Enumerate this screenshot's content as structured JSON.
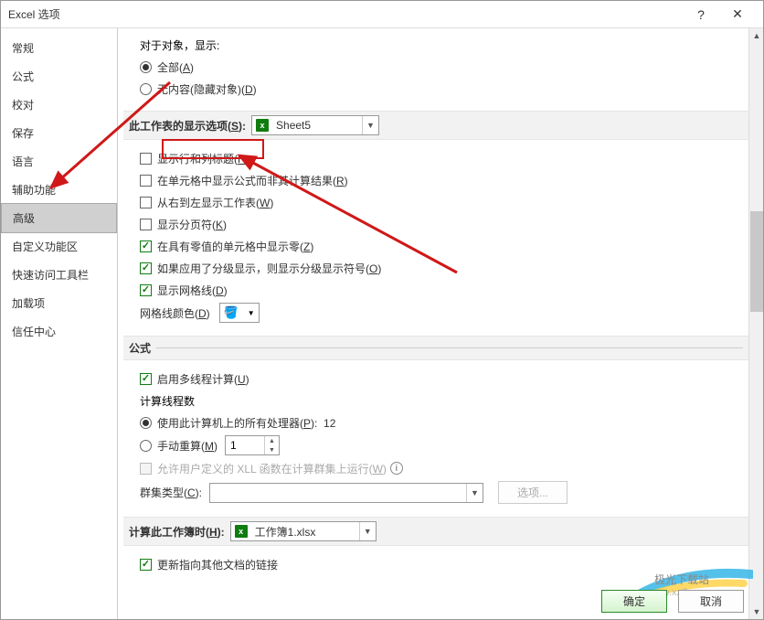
{
  "titlebar": {
    "title": "Excel 选项",
    "help": "?",
    "close": "✕"
  },
  "sidebar": {
    "items": [
      {
        "label": "常规"
      },
      {
        "label": "公式"
      },
      {
        "label": "校对"
      },
      {
        "label": "保存"
      },
      {
        "label": "语言"
      },
      {
        "label": "辅助功能"
      },
      {
        "label": "高级",
        "selected": true
      },
      {
        "label": "自定义功能区"
      },
      {
        "label": "快速访问工具栏"
      },
      {
        "label": "加载项"
      },
      {
        "label": "信任中心"
      }
    ]
  },
  "content": {
    "objects": {
      "label": "对于对象，显示:",
      "all": "全部(A)",
      "none": "无内容(隐藏对象)(D)"
    },
    "worksheet": {
      "header": "此工作表的显示选项(S):",
      "sheet": "Sheet5",
      "show_headers": "显示行和列标题(H)",
      "show_formulas": "在单元格中显示公式而非其计算结果(R)",
      "rtl": "从右到左显示工作表(W)",
      "pagebreaks": "显示分页符(K)",
      "zero": "在具有零值的单元格中显示零(Z)",
      "outline": "如果应用了分级显示，则显示分级显示符号(O)",
      "gridlines": "显示网格线(D)",
      "gridcolor_label": "网格线颜色(D)"
    },
    "formulas": {
      "header": "公式",
      "multithread": "启用多线程计算(U)",
      "threads_label": "计算线程数",
      "use_all": "使用此计算机上的所有处理器(P):",
      "proc_count": "12",
      "manual": "手动重算(M)",
      "manual_val": "1",
      "xll_label": "允许用户定义的 XLL 函数在计算群集上运行(W)",
      "cluster_label": "群集类型(C):",
      "options_btn": "选项..."
    },
    "workbook": {
      "header": "计算此工作簿时(H):",
      "file": "工作簿1.xlsx",
      "update_links": "更新指向其他文档的链接"
    }
  },
  "footer": {
    "ok": "确定",
    "cancel": "取消",
    "brand": "极光下载站",
    "url": "www.xz7.com"
  }
}
